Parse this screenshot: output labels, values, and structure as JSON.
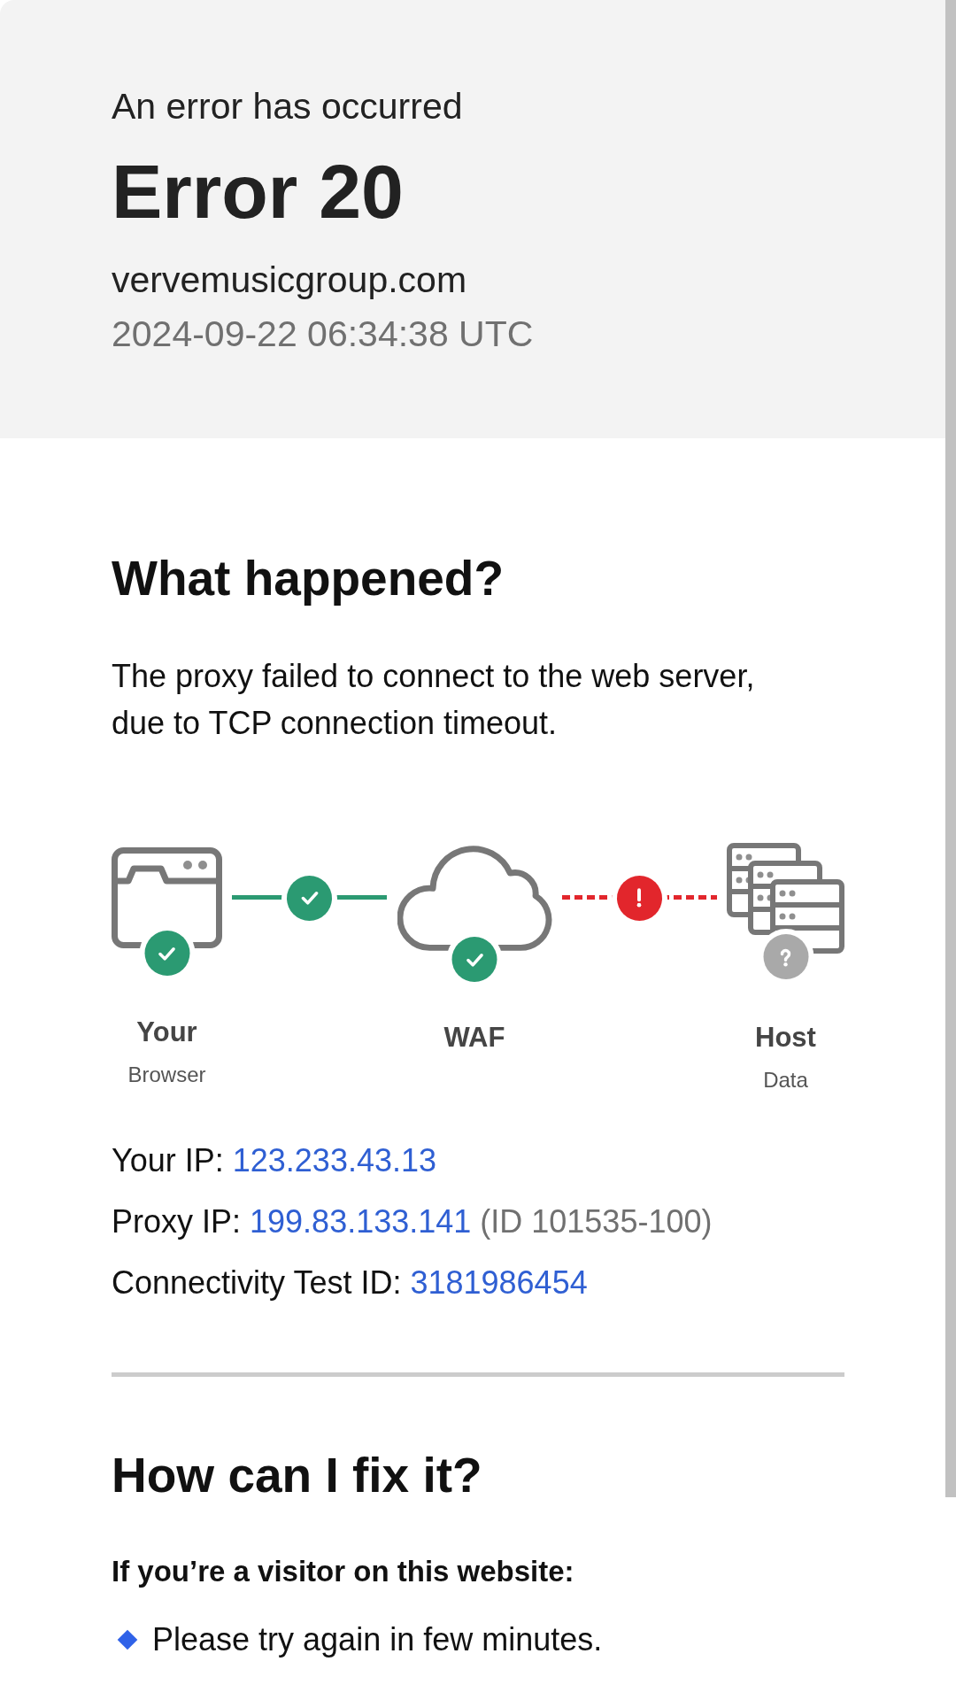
{
  "header": {
    "subtitle": "An error has occurred",
    "title": "Error 20",
    "domain": "vervemusicgroup.com",
    "timestamp": "2024-09-22 06:34:38 UTC"
  },
  "what_happened": {
    "heading": "What happened?",
    "text": "The proxy failed to connect to the web server, due to TCP connection timeout."
  },
  "diagram": {
    "nodes": [
      {
        "kind": "browser",
        "label": "Your",
        "sublabel": "Browser",
        "badge": {
          "kind": "check"
        }
      },
      {
        "kind": "cloud",
        "label": "WAF",
        "badge": {
          "kind": "check"
        }
      },
      {
        "kind": "server",
        "label": "Host",
        "sublabel": "Data",
        "badge": {
          "kind": "question"
        }
      }
    ],
    "links": [
      {
        "kind": "solid",
        "badge": {
          "kind": "check"
        }
      },
      {
        "kind": "dashed",
        "badge": {
          "kind": "alert"
        }
      }
    ]
  },
  "details": [
    {
      "label": "Your IP:",
      "value": "123.233.43.13"
    },
    {
      "label": "Proxy IP:",
      "value": "199.83.133.141",
      "note": "(ID 101535-100)"
    },
    {
      "label": "Connectivity Test ID:",
      "value": "3181986454"
    }
  ],
  "fix": {
    "heading": "How can I fix it?",
    "subheading": "If you’re a visitor on this website:",
    "items": [
      "Please try again in few minutes."
    ]
  }
}
